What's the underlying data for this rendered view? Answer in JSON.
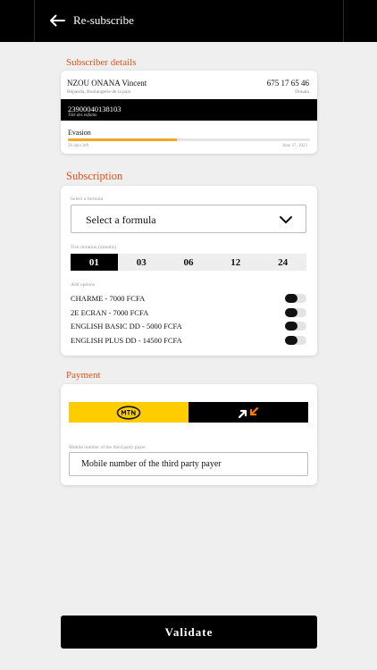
{
  "header": {
    "title": "Re-subscribe",
    "back_icon": "arrow-left-icon"
  },
  "subscriber": {
    "section_title": "Subscriber details",
    "name": "NZOU ONANA Vincent",
    "phone": "675 17 65 46",
    "address": "Bépanda, Boulangerie de la paix",
    "city": "Douala",
    "decoder_number": "23900040138103",
    "decoder_label": "Télé des enfants",
    "plan": "Evasion",
    "days_left": "26 days left",
    "expiry_date": "June 27, 2023",
    "progress_fraction": 0.45,
    "progress_color": "#f5a623"
  },
  "subscription": {
    "section_title": "Subscription",
    "formula_label": "Select a formula",
    "formula_value": "Select a formula",
    "duration_label": "Tick duration (months)",
    "durations": [
      "01",
      "03",
      "06",
      "12",
      "24"
    ],
    "selected_duration": "01",
    "options_label": "Add options",
    "options": [
      {
        "label": "CHARME - 7000 FCFA",
        "enabled": false
      },
      {
        "label": "2E ECRAN - 7000 FCFA",
        "enabled": false
      },
      {
        "label": "ENGLISH BASIC DD - 5000 FCFA",
        "enabled": false
      },
      {
        "label": "ENGLISH PLUS DD - 14500 FCFA",
        "enabled": false
      }
    ]
  },
  "payment": {
    "section_title": "Payment",
    "methods": [
      {
        "name": "MTN",
        "color": "#ffcc00"
      },
      {
        "name": "Orange",
        "color": "#000000"
      }
    ],
    "payer_label": "Mobile number of the third party payer",
    "payer_placeholder": "Mobile number of the third party payer"
  },
  "validate_label": "Validate",
  "colors": {
    "accent": "#e0521a",
    "dark": "#000000",
    "background": "#efefef"
  }
}
